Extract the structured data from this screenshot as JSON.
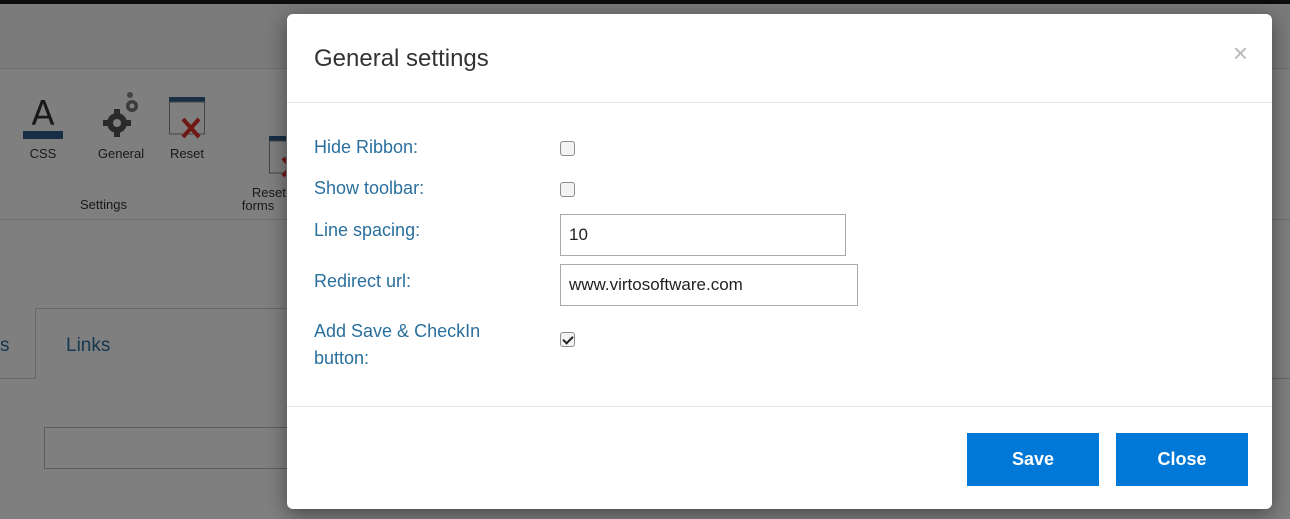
{
  "ribbon": {
    "buttons": [
      {
        "label": "CSS",
        "icon": "text-color-a-icon"
      },
      {
        "label": "General",
        "icon": "gears-icon"
      },
      {
        "label": "Reset",
        "icon": "reset-x-icon"
      },
      {
        "label": "Reset\nforms",
        "icon": "reset-forms-x-icon"
      }
    ],
    "group_label": "Settings"
  },
  "background_tabs": {
    "prev_fragment": "s",
    "links_label": "Links"
  },
  "modal": {
    "title": "General settings",
    "close_glyph": "×",
    "fields": {
      "hide_ribbon": {
        "label": "Hide Ribbon:",
        "checked": false
      },
      "show_toolbar": {
        "label": "Show toolbar:",
        "checked": false
      },
      "line_spacing": {
        "label": "Line spacing:",
        "value": "10"
      },
      "redirect_url": {
        "label": "Redirect url:",
        "value": "www.virtosoftware.com"
      },
      "add_save_checkin": {
        "label_line1": "Add Save & CheckIn",
        "label_line2": "button:",
        "checked": true
      }
    },
    "buttons": {
      "save": "Save",
      "close": "Close"
    }
  },
  "colors": {
    "accent_blue": "#0078d7",
    "label_blue": "#2a6f9e",
    "icon_navy": "#2f5c8a",
    "icon_red": "#e0312a"
  }
}
